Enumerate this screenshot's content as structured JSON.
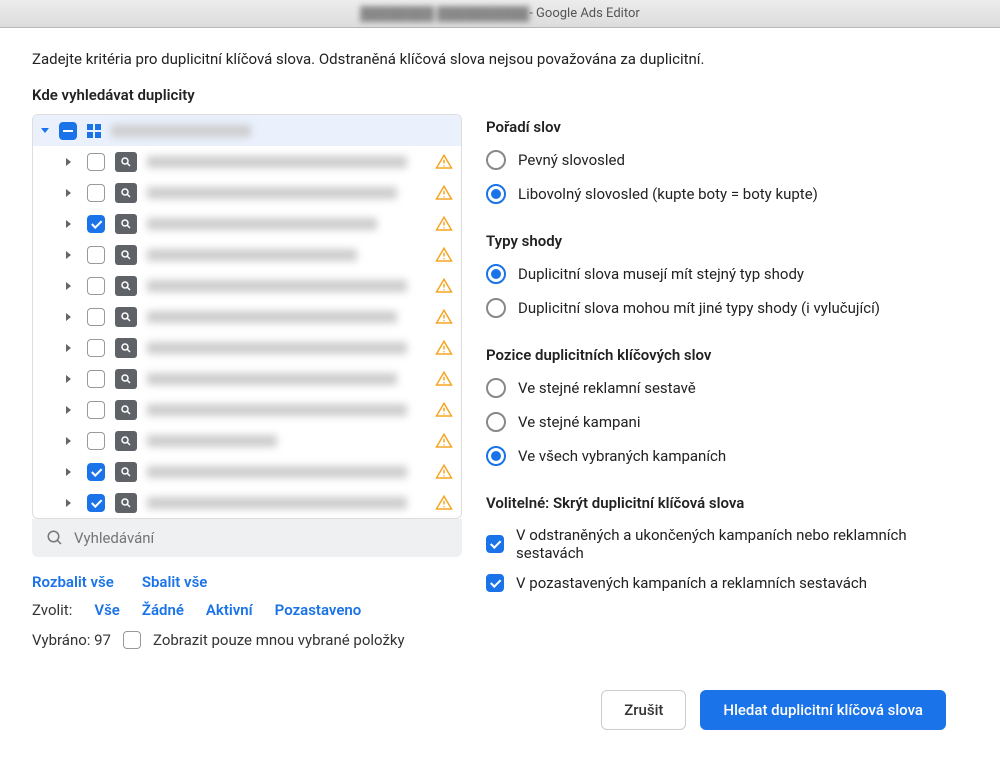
{
  "window": {
    "title_suffix": " - Google Ads Editor",
    "title_blur": "████████ ██████████"
  },
  "instruction": "Zadejte kritéria pro duplicitní klíčová slova. Odstraněná klíčová slova nejsou považována za duplicitní.",
  "left_section_label": "Kde vyhledávat duplicity",
  "tree": {
    "root_blur": "███████████████",
    "items": [
      {
        "checked": false
      },
      {
        "checked": false
      },
      {
        "checked": true
      },
      {
        "checked": false
      },
      {
        "checked": false
      },
      {
        "checked": false
      },
      {
        "checked": false
      },
      {
        "checked": false
      },
      {
        "checked": false
      },
      {
        "checked": false
      },
      {
        "checked": true
      },
      {
        "checked": true
      }
    ]
  },
  "search": {
    "placeholder": "Vyhledávání"
  },
  "links": {
    "expand_all": "Rozbalit vše",
    "collapse_all": "Sbalit vše"
  },
  "select": {
    "label": "Zvolit:",
    "all": "Vše",
    "none": "Žádné",
    "active": "Aktivní",
    "paused": "Pozastaveno"
  },
  "status": {
    "selected_label": "Vybráno: 97",
    "show_only_mine": "Zobrazit pouze mnou vybrané položky"
  },
  "right": {
    "word_order": {
      "title": "Pořadí slov",
      "fixed": "Pevný slovosled",
      "any": "Libovolný slovosled (kupte boty = boty kupte)",
      "selected": "any"
    },
    "match_types": {
      "title": "Typy shody",
      "same": "Duplicitní slova musejí mít stejný typ shody",
      "diff": "Duplicitní slova mohou mít jiné typy shody (i vylučující)",
      "selected": "same"
    },
    "position": {
      "title": "Pozice duplicitních klíčových slov",
      "adgroup": "Ve stejné reklamní sestavě",
      "campaign": "Ve stejné kampani",
      "all": "Ve všech vybraných kampaních",
      "selected": "all"
    },
    "optional": {
      "title": "Volitelné: Skrýt duplicitní klíčová slova",
      "opt1": "V odstraněných a ukončených kampaních nebo reklamních sestavách",
      "opt2": "V pozastavených kampaních a reklamních sestavách"
    }
  },
  "buttons": {
    "cancel": "Zrušit",
    "find": "Hledat duplicitní klíčová slova"
  }
}
